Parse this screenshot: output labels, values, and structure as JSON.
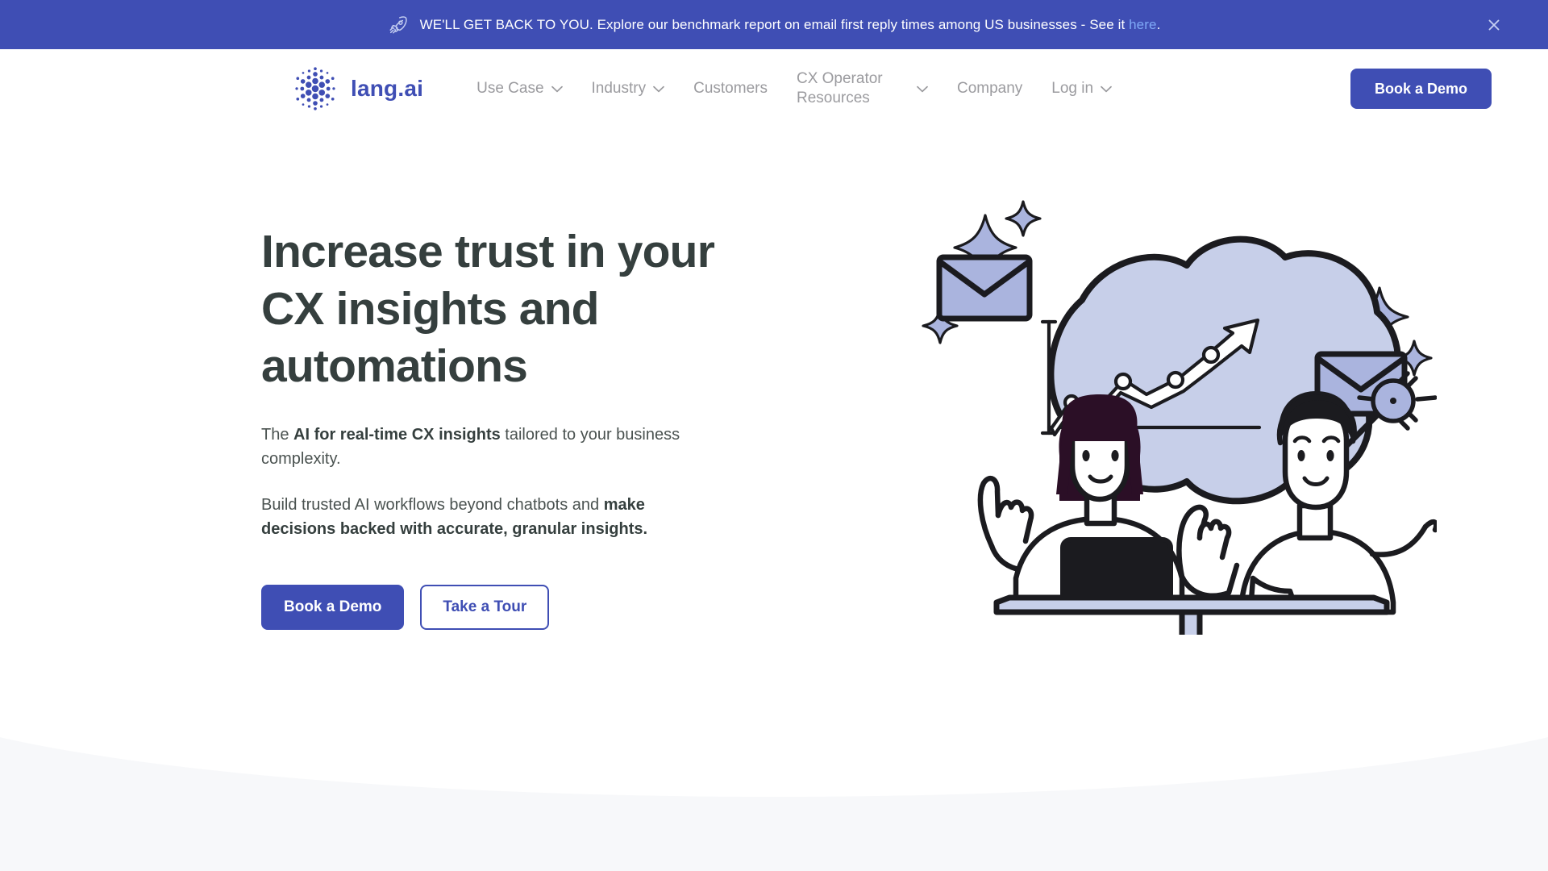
{
  "colors": {
    "brand_indigo": "#3f4eb4",
    "banner_bg": "#3f4eb4",
    "banner_link": "#7fa9f7",
    "heading": "#353f3e",
    "body_text": "#4a5250",
    "nav_link": "#9b9b9f",
    "page_bg": "#f7f8fa",
    "surface": "#ffffff",
    "illustration_periwinkle": "#aab4de",
    "illustration_cloud": "#c7cfe9",
    "illustration_ink": "#1b1b1f",
    "illustration_hair_dark": "#2b0f26"
  },
  "banner": {
    "icon": "rocket-icon",
    "text_before_link": "WE'LL GET BACK TO YOU. Explore our benchmark report on email first reply times among US businesses - See it ",
    "link_label": "here",
    "text_after_link": ".",
    "close_icon": "close-icon"
  },
  "nav": {
    "logo_icon": "lang-ai-dot-mandala-logo",
    "brand": "lang.ai",
    "items": [
      {
        "label": "Use Case",
        "has_dropdown": true,
        "icon": "chevron-down-icon"
      },
      {
        "label": "Industry",
        "has_dropdown": true,
        "icon": "chevron-down-icon"
      },
      {
        "label": "Customers",
        "has_dropdown": false
      },
      {
        "label": "CX Operator Resources",
        "has_dropdown": true,
        "icon": "chevron-down-icon"
      },
      {
        "label": "Company",
        "has_dropdown": false
      },
      {
        "label": "Log in",
        "has_dropdown": true,
        "icon": "chevron-down-icon"
      }
    ],
    "cta_label": "Book a Demo"
  },
  "hero": {
    "title": "Increase trust in your CX insights and automations",
    "paragraph_1": {
      "lead": "The ",
      "bold": "AI for real-time CX insights",
      "tail": " tailored to your business complexity."
    },
    "paragraph_2": {
      "lead": "Build trusted AI workflows beyond chatbots and ",
      "bold": "make decisions backed with accurate, granular insights."
    },
    "primary_cta": "Book a Demo",
    "secondary_cta": "Take a Tour",
    "illustration": {
      "name": "two-people-at-desk-with-growth-chart-cloud",
      "elements": [
        "thought-cloud",
        "line-chart-upward-arrow",
        "envelope-icon-left",
        "envelope-icon-right",
        "sparkle-icon",
        "magic-wand-icon",
        "person-woman-with-laptop",
        "person-man-pointing",
        "desk-table"
      ]
    }
  }
}
